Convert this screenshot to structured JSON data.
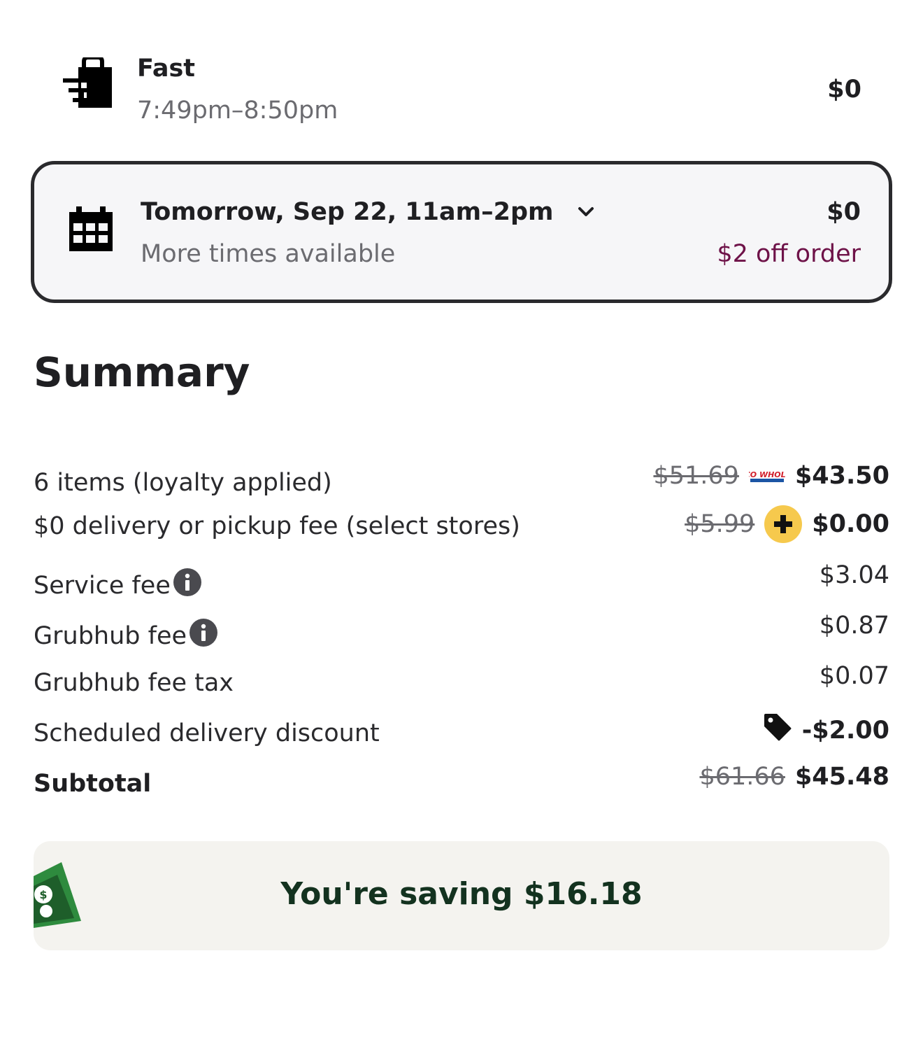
{
  "delivery_options": {
    "fast": {
      "title": "Fast",
      "time": "7:49pm–8:50pm",
      "price": "$0",
      "icon": "shopping-bag-fast-icon"
    },
    "scheduled": {
      "title": "Tomorrow, Sep 22, 11am–2pm",
      "subtitle": "More times available",
      "price": "$0",
      "discount": "$2 off order",
      "icon": "calendar-icon",
      "selected": true
    }
  },
  "summary": {
    "title": "Summary",
    "rows": [
      {
        "label": "6 items (loyalty applied)",
        "original": "$51.69",
        "value": "$43.50"
      },
      {
        "label": "$0 delivery or pickup fee (select stores)",
        "original": "$5.99",
        "value": "$0.00"
      },
      {
        "label": "Service fee",
        "value": "$3.04"
      },
      {
        "label": "Grubhub fee",
        "value": "$0.87"
      },
      {
        "label": "Grubhub fee tax",
        "value": "$0.07"
      },
      {
        "label": "Scheduled delivery discount",
        "value": "-$2.00"
      },
      {
        "label": "Subtotal",
        "original": "$61.66",
        "value": "$45.48"
      }
    ],
    "costco_logo_text": "COSTCO WHOLESALE"
  },
  "savings": {
    "text": "You're saving $16.18"
  },
  "colors": {
    "border": "#2a2a2d",
    "discount": "#6e1248",
    "plus_badge": "#f6c94d",
    "savings_text": "#13321f",
    "savings_bg": "#f4f3ef"
  }
}
